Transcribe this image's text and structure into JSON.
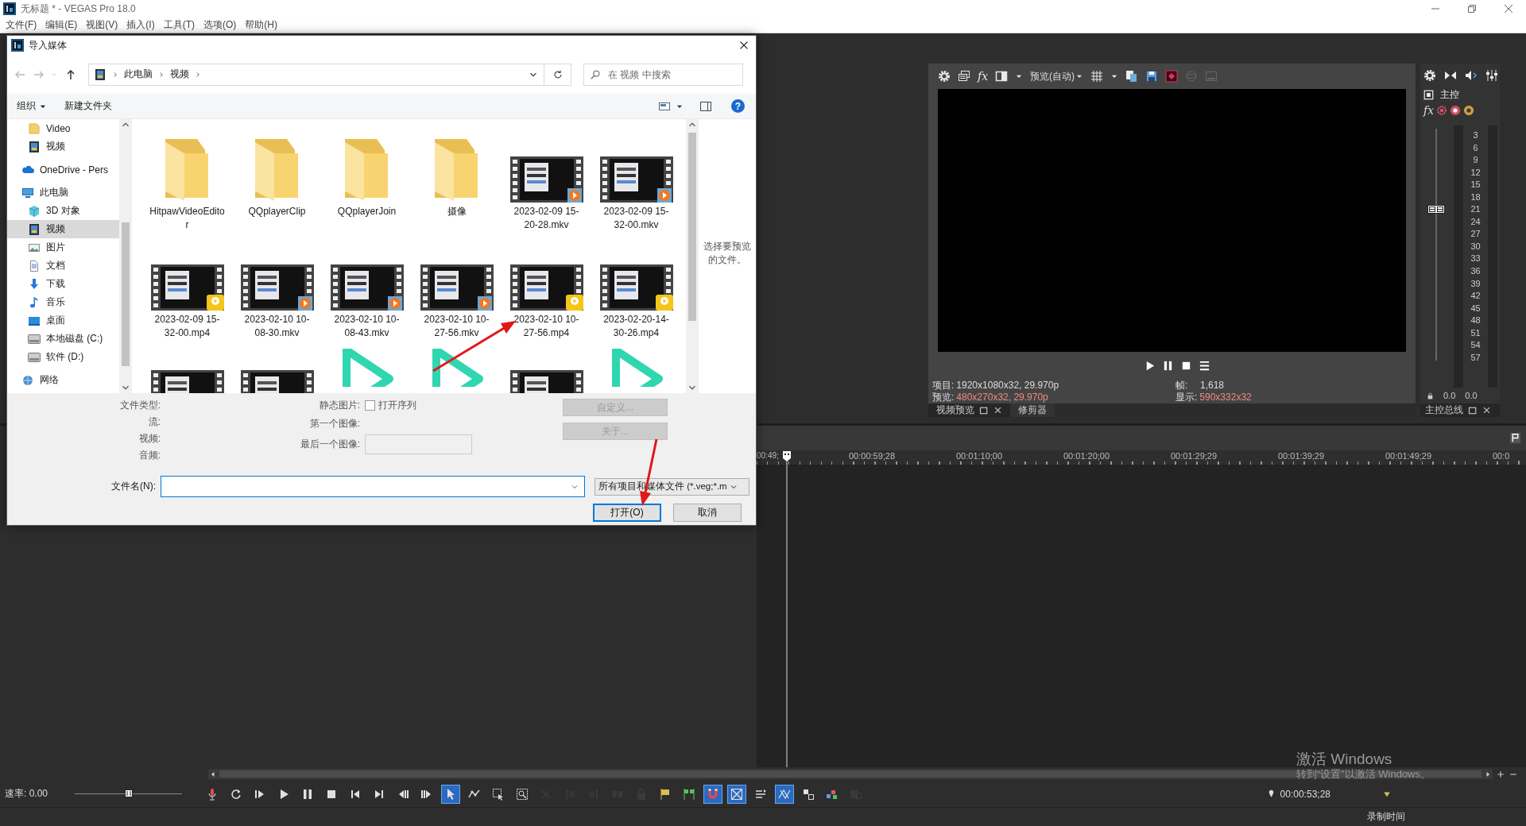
{
  "window": {
    "title": "无标题 * - VEGAS Pro 18.0"
  },
  "menu": [
    "文件(F)",
    "编辑(E)",
    "视图(V)",
    "插入(I)",
    "工具(T)",
    "选项(O)",
    "帮助(H)"
  ],
  "dialog": {
    "title": "导入媒体",
    "path": [
      "此电脑",
      "视频"
    ],
    "search": {
      "placeholder": "在 视频 中搜索"
    },
    "commands": [
      "组织",
      "新建文件夹"
    ],
    "help": "?",
    "nav": [
      {
        "children": [
          {
            "kind": "folder",
            "label": "Video",
            "selected": false
          },
          {
            "kind": "video",
            "label": "视频",
            "selected": false
          }
        ]
      },
      {
        "kind": "cloud",
        "label": "OneDrive - Pers",
        "selected": false
      },
      {
        "kind": "computer",
        "label": "此电脑",
        "selected": false,
        "children": [
          {
            "kind": "cube",
            "label": "3D 对象",
            "selected": false
          },
          {
            "kind": "video",
            "label": "视频",
            "selected": true
          },
          {
            "kind": "image",
            "label": "图片",
            "selected": false
          },
          {
            "kind": "document",
            "label": "文档",
            "selected": false
          },
          {
            "kind": "download",
            "label": "下载",
            "selected": false
          },
          {
            "kind": "music",
            "label": "音乐",
            "selected": false
          },
          {
            "kind": "desktop",
            "label": "桌面",
            "selected": false
          },
          {
            "kind": "drive",
            "label": "本地磁盘 (C:)",
            "selected": false
          },
          {
            "kind": "drive",
            "label": "软件 (D:)",
            "selected": false
          }
        ]
      },
      {
        "kind": "network",
        "label": "网络",
        "selected": false
      }
    ],
    "files": [
      {
        "kind": "folder",
        "label": "HitpawVideoEditor"
      },
      {
        "kind": "folder",
        "label": "QQplayerClip"
      },
      {
        "kind": "folder",
        "label": "QQplayerJoin"
      },
      {
        "kind": "folder",
        "label": "摄像"
      },
      {
        "kind": "video",
        "label": "2023-02-09 15-20-28.mkv"
      },
      {
        "kind": "video",
        "label": "2023-02-09 15-32-00.mkv"
      },
      {
        "kind": "playervideo",
        "label": "2023-02-09 15-32-00.mp4"
      },
      {
        "kind": "video",
        "label": "2023-02-10 10-08-30.mkv"
      },
      {
        "kind": "video",
        "label": "2023-02-10 10-08-43.mkv"
      },
      {
        "kind": "video",
        "label": "2023-02-10 10-27-56.mkv"
      },
      {
        "kind": "playervideo",
        "label": "2023-02-10 10-27-56.mp4"
      },
      {
        "kind": "playervideo",
        "label": "2023-02-20-14-30-26.mp4"
      },
      {
        "kind": "video"
      },
      {
        "kind": "video"
      },
      {
        "kind": "play"
      },
      {
        "kind": "play"
      },
      {
        "kind": "video"
      },
      {
        "kind": "play"
      }
    ],
    "preview_hint": "选择要预览的文件。",
    "info_labels": [
      "文件类型:",
      "流:",
      "视频:",
      "音频:"
    ],
    "still": {
      "label": "静态图片:",
      "option": "打开序列",
      "checked": false
    },
    "image_labels": [
      "第一个图像:",
      "最后一个图像:"
    ],
    "side_buttons": [
      {
        "label": "自定义...",
        "disabled": true
      },
      {
        "label": "关于...",
        "disabled": true
      }
    ],
    "filename_label": "文件名(N):",
    "filter": "所有项目和媒体文件 (*.veg;*.m",
    "actions": [
      {
        "label": "打开(O)",
        "default": true
      },
      {
        "label": "取消",
        "default": false
      }
    ]
  },
  "preview": {
    "fx": "fx",
    "mode": "预览(自动)",
    "project_label": "项目:",
    "project": "1920x1080x32, 29.970p",
    "frame_label": "帧:",
    "frame": "1,618",
    "preview_label": "预览:",
    "preview_value": "480x270x32, 29.970p",
    "display_label": "显示:",
    "display": "590x332x32",
    "tabs": [
      {
        "label": "视频预览",
        "selected": true
      },
      {
        "label": "修剪器",
        "selected": false
      }
    ]
  },
  "master": {
    "title": "主控",
    "fx": "fx",
    "fader": {
      "level": 0.65
    },
    "scale": [
      "3",
      "6",
      "9",
      "12",
      "15",
      "18",
      "21",
      "24",
      "27",
      "30",
      "33",
      "36",
      "39",
      "42",
      "45",
      "48",
      "51",
      "54",
      "57"
    ],
    "readings": [
      "0.0",
      "0.0"
    ],
    "tab": "主控总线"
  },
  "timeline": {
    "ruler": [
      "00:49;",
      "00:00:59;28",
      "00:01:10;00",
      "00:01:20;00",
      "00:01:29;29",
      "00:01:39;29",
      "00:01:49;29",
      "00:0"
    ]
  },
  "transport": {
    "rate": "速率: 0.00",
    "rate_slider": {
      "level": 0.5
    },
    "timecode": "00:00:53;28",
    "tools": [
      {
        "kind": "mic",
        "on": false,
        "disabled": false
      },
      {
        "kind": "loop",
        "on": false,
        "disabled": false
      },
      {
        "kind": "playstart",
        "on": false,
        "disabled": false
      },
      {
        "kind": "play",
        "on": false,
        "disabled": false
      },
      {
        "kind": "pause",
        "on": false,
        "disabled": false
      },
      {
        "kind": "stop",
        "on": false,
        "disabled": false
      },
      {
        "kind": "tostart",
        "on": false,
        "disabled": false
      },
      {
        "kind": "toend",
        "on": false,
        "disabled": false
      },
      {
        "kind": "prevframe",
        "on": false,
        "disabled": false
      },
      {
        "kind": "nextframe",
        "on": false,
        "disabled": false
      },
      {
        "kind": "edit",
        "on": true,
        "disabled": false
      },
      {
        "kind": "envelope",
        "on": false,
        "disabled": false
      },
      {
        "kind": "select",
        "on": false,
        "disabled": false
      },
      {
        "kind": "zoom",
        "on": false,
        "disabled": false
      },
      {
        "kind": "delete",
        "on": false,
        "disabled": true
      },
      {
        "kind": "trimstart",
        "on": false,
        "disabled": true
      },
      {
        "kind": "trimend",
        "on": false,
        "disabled": true
      },
      {
        "kind": "split",
        "on": false,
        "disabled": true
      },
      {
        "kind": "lock",
        "on": false,
        "disabled": true
      },
      {
        "kind": "marker",
        "on": false,
        "disabled": false
      },
      {
        "kind": "region",
        "on": false,
        "disabled": false
      },
      {
        "kind": "snap",
        "on": true,
        "disabled": false
      },
      {
        "kind": "quantize",
        "on": true,
        "disabled": false
      },
      {
        "kind": "ripple",
        "on": false,
        "disabled": false
      },
      {
        "kind": "autocross",
        "on": true,
        "disabled": false
      },
      {
        "kind": "group",
        "on": false,
        "disabled": false
      },
      {
        "kind": "layout",
        "on": false,
        "disabled": false
      },
      {
        "kind": "effects",
        "on": false,
        "disabled": true
      }
    ]
  },
  "status": "录制时间",
  "activation": {
    "title": "激活 Windows",
    "hint": "转到“设置”以激活 Windows。"
  }
}
